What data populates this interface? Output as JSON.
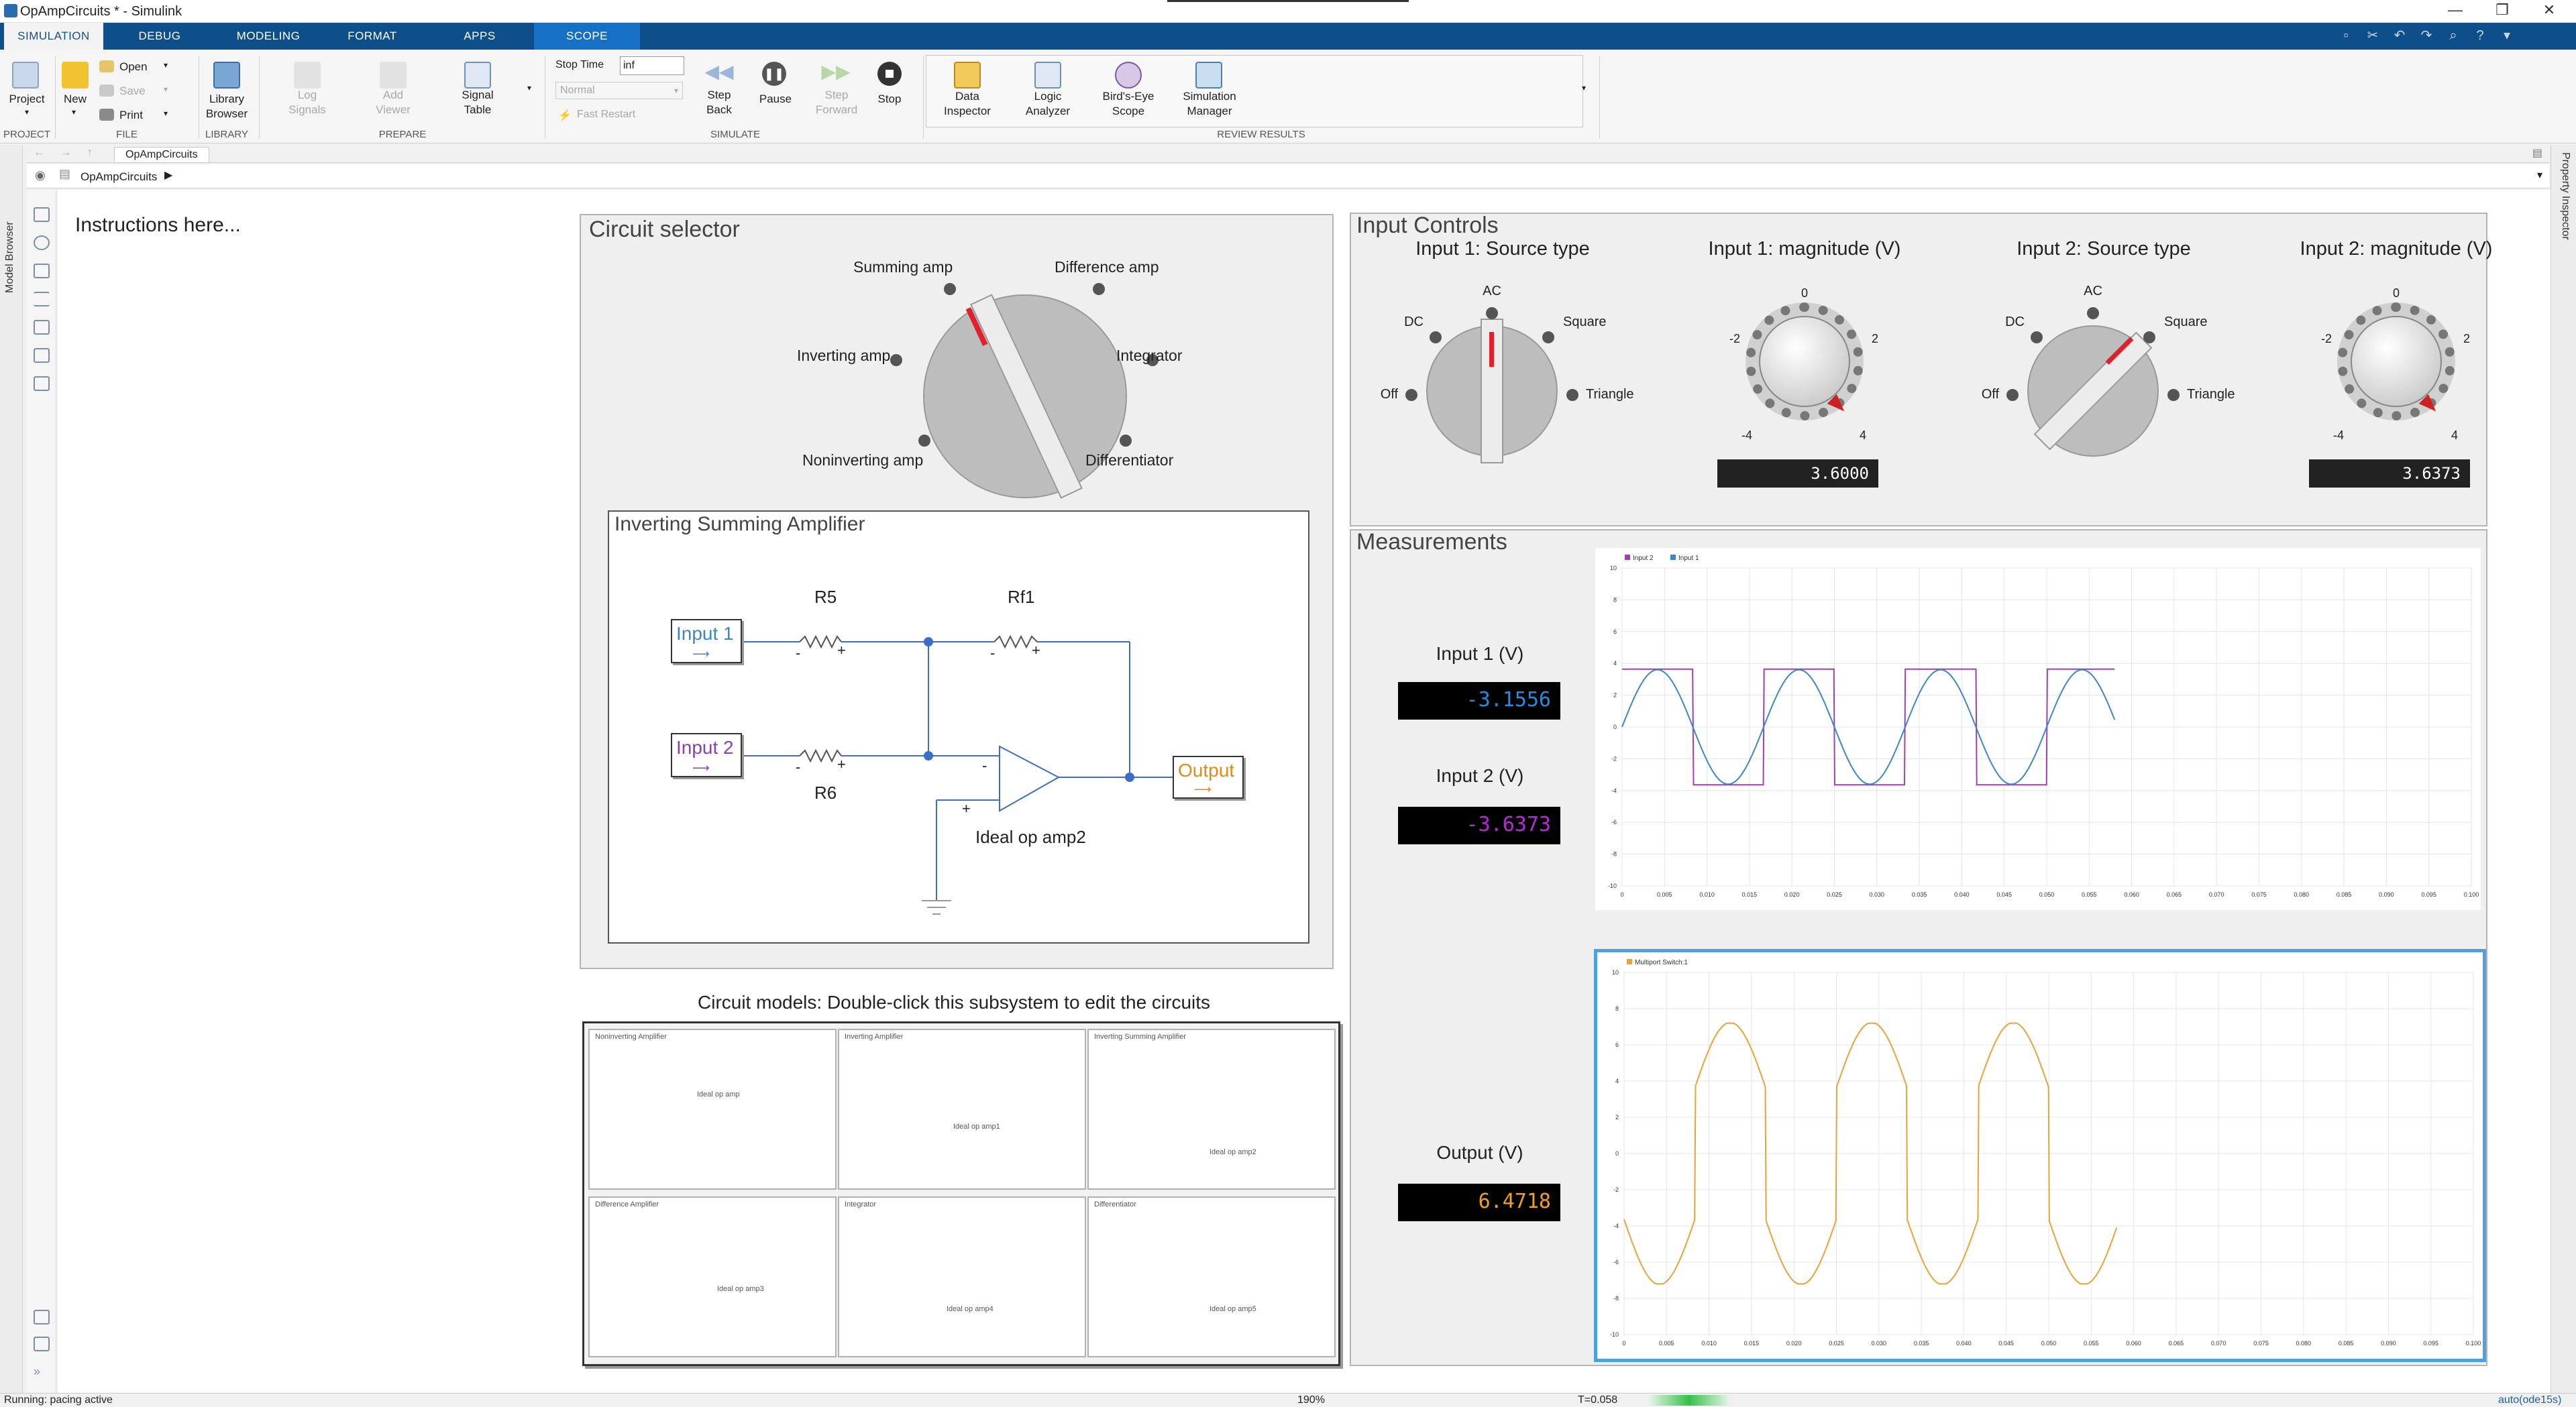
{
  "window": {
    "title": "OpAmpCircuits * - Simulink"
  },
  "tabs": [
    "SIMULATION",
    "DEBUG",
    "MODELING",
    "FORMAT",
    "APPS",
    "SCOPE"
  ],
  "toolstrip": {
    "project": "Project",
    "new": "New",
    "open": "Open",
    "save": "Save",
    "print": "Print",
    "library_browser": [
      "Library",
      "Browser"
    ],
    "log_signals": [
      "Log",
      "Signals"
    ],
    "add_viewer": [
      "Add",
      "Viewer"
    ],
    "signal_table": [
      "Signal",
      "Table"
    ],
    "stop_time_label": "Stop Time",
    "stop_time_value": "inf",
    "mode": "Normal",
    "fast_restart": "Fast Restart",
    "step_back": [
      "Step",
      "Back"
    ],
    "pause": "Pause",
    "step_forward": [
      "Step",
      "Forward"
    ],
    "stop": "Stop",
    "data_inspector": [
      "Data",
      "Inspector"
    ],
    "logic_analyzer": [
      "Logic",
      "Analyzer"
    ],
    "birds_eye_scope": [
      "Bird's-Eye",
      "Scope"
    ],
    "simulation_manager": [
      "Simulation",
      "Manager"
    ],
    "sections": [
      "PROJECT",
      "FILE",
      "LIBRARY",
      "PREPARE",
      "SIMULATE",
      "REVIEW RESULTS"
    ]
  },
  "model_tab": "OpAmpCircuits",
  "breadcrumb": "OpAmpCircuits",
  "side_labels": {
    "left": "Model Browser",
    "right": "Property Inspector"
  },
  "instructions": "Instructions here...",
  "circuit_selector": {
    "title": "Circuit selector",
    "options": [
      "Summing amp",
      "Difference amp",
      "Inverting amp",
      "Integrator",
      "Noninverting amp",
      "Differentiator"
    ],
    "selected": "Summing amp"
  },
  "schematic": {
    "title": "Inverting Summing Amplifier",
    "input1": "Input 1",
    "input2": "Input 2",
    "r5": "R5",
    "rf1": "Rf1",
    "r6": "R6",
    "opamp": "Ideal op amp2",
    "output": "Output",
    "minus": "-",
    "plus": "+"
  },
  "circuit_models": {
    "caption": "Circuit models: Double-click this subsystem to edit the circuits",
    "tiles": [
      "Noninverting Amplifier",
      "Inverting Amplifier",
      "Inverting Summing Amplifier",
      "Difference Amplifier",
      "Integrator",
      "Differentiator"
    ],
    "tile_opamps": [
      "Ideal op amp",
      "Ideal op amp1",
      "Ideal op amp2",
      "Ideal op amp3",
      "Ideal op amp4",
      "Ideal op amp5"
    ]
  },
  "input_controls": {
    "title": "Input Controls",
    "source_labels": {
      "dc": "DC",
      "ac": "AC",
      "square": "Square",
      "off": "Off",
      "triangle": "Triangle"
    },
    "input1_source": {
      "title": "Input 1: Source type",
      "selected": "AC"
    },
    "input1_mag": {
      "title": "Input 1: magnitude (V)",
      "value": "3.6000",
      "ticks": [
        "0",
        "-2",
        "2",
        "-4",
        "4"
      ]
    },
    "input2_source": {
      "title": "Input 2: Source type",
      "selected": "Square"
    },
    "input2_mag": {
      "title": "Input 2: magnitude (V)",
      "value": "3.6373",
      "ticks": [
        "0",
        "-2",
        "2",
        "-4",
        "4"
      ]
    }
  },
  "measurements": {
    "title": "Measurements",
    "input1": {
      "label": "Input 1 (V)",
      "value": "-3.1556",
      "color": "#2d8ad6"
    },
    "input2": {
      "label": "Input 2 (V)",
      "value": "-3.6373",
      "color": "#b42bd6"
    },
    "output": {
      "label": "Output (V)",
      "value": "6.4718",
      "color": "#f0a020"
    }
  },
  "chart_data": [
    {
      "type": "line",
      "legend": [
        "Input 2",
        "Input 1"
      ],
      "legend_placement": "top-left",
      "grid": true,
      "xlim": [
        0,
        0.1
      ],
      "ylim": [
        -10,
        10
      ],
      "x_ticks": [
        "0",
        "0.005",
        "0.010",
        "0.015",
        "0.020",
        "0.025",
        "0.030",
        "0.035",
        "0.040",
        "0.045",
        "0.050",
        "0.055",
        "0.060",
        "0.065",
        "0.070",
        "0.075",
        "0.080",
        "0.085",
        "0.090",
        "0.095",
        "0.100"
      ],
      "y_ticks": [
        "10",
        "8",
        "6",
        "4",
        "2",
        "0",
        "-2",
        "-4",
        "-6",
        "-8",
        "-10"
      ],
      "series": [
        {
          "name": "Input 2",
          "color": "#a040b0",
          "kind": "square",
          "amplitude": 3.6373,
          "frequency_hz": 60,
          "x_end": 0.058
        },
        {
          "name": "Input 1",
          "color": "#3d86c6",
          "kind": "sine",
          "amplitude": 3.6,
          "frequency_hz": 60,
          "x_end": 0.058
        }
      ]
    },
    {
      "type": "line",
      "legend": [
        "Multiport Switch:1"
      ],
      "legend_placement": "top-left",
      "grid": true,
      "xlim": [
        0,
        0.1
      ],
      "ylim": [
        -10,
        10
      ],
      "x_ticks": [
        "0",
        "0.005",
        "0.010",
        "0.015",
        "0.020",
        "0.025",
        "0.030",
        "0.035",
        "0.040",
        "0.045",
        "0.050",
        "0.055",
        "0.060",
        "0.065",
        "0.070",
        "0.075",
        "0.080",
        "0.085",
        "0.090",
        "0.095",
        "0.100"
      ],
      "y_ticks": [
        "10",
        "8",
        "6",
        "4",
        "2",
        "0",
        "-2",
        "-4",
        "-6",
        "-8",
        "-10"
      ],
      "series": [
        {
          "name": "Multiport Switch:1",
          "color": "#e8a23a",
          "kind": "sum",
          "amplitude": 7.2,
          "frequency_hz": 60,
          "x_end": 0.058
        }
      ]
    }
  ],
  "status": {
    "left": "Running: pacing active",
    "zoom": "190%",
    "time": "T=0.058",
    "solver": "auto(ode15s)"
  }
}
